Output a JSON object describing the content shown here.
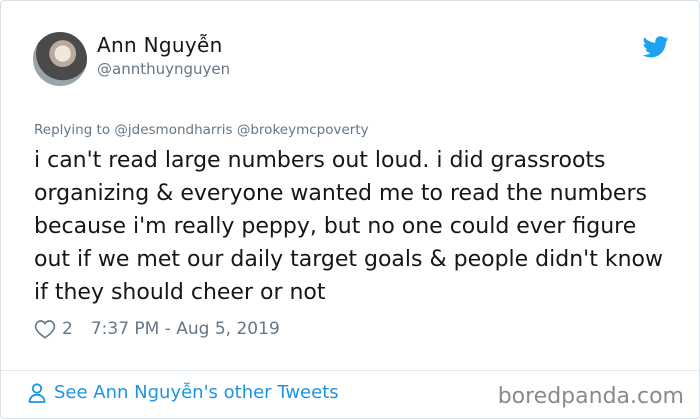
{
  "tweet": {
    "author_name": "Ann Nguyễn",
    "author_handle": "@annthuynguyen",
    "replying_to": "Replying to @jdesmondharris @brokeymcpoverty",
    "text": "i can't read large numbers out loud. i did grassroots organizing & everyone wanted me to read the numbers because i'm really peppy, but no one could ever figure out if we met our daily target goals & people didn't know if they should cheer or not",
    "likes": "2",
    "timestamp": "7:37 PM - Aug 5, 2019",
    "see_more": "See Ann Nguyễn's other Tweets"
  },
  "watermark": "boredpanda.com",
  "icons": {
    "brand": "twitter-bird-icon",
    "like": "heart-icon",
    "profile": "person-icon"
  },
  "colors": {
    "twitter_blue": "#1da1f2",
    "link_blue": "#1b95e0",
    "text": "#14171a",
    "secondary": "#657786"
  }
}
